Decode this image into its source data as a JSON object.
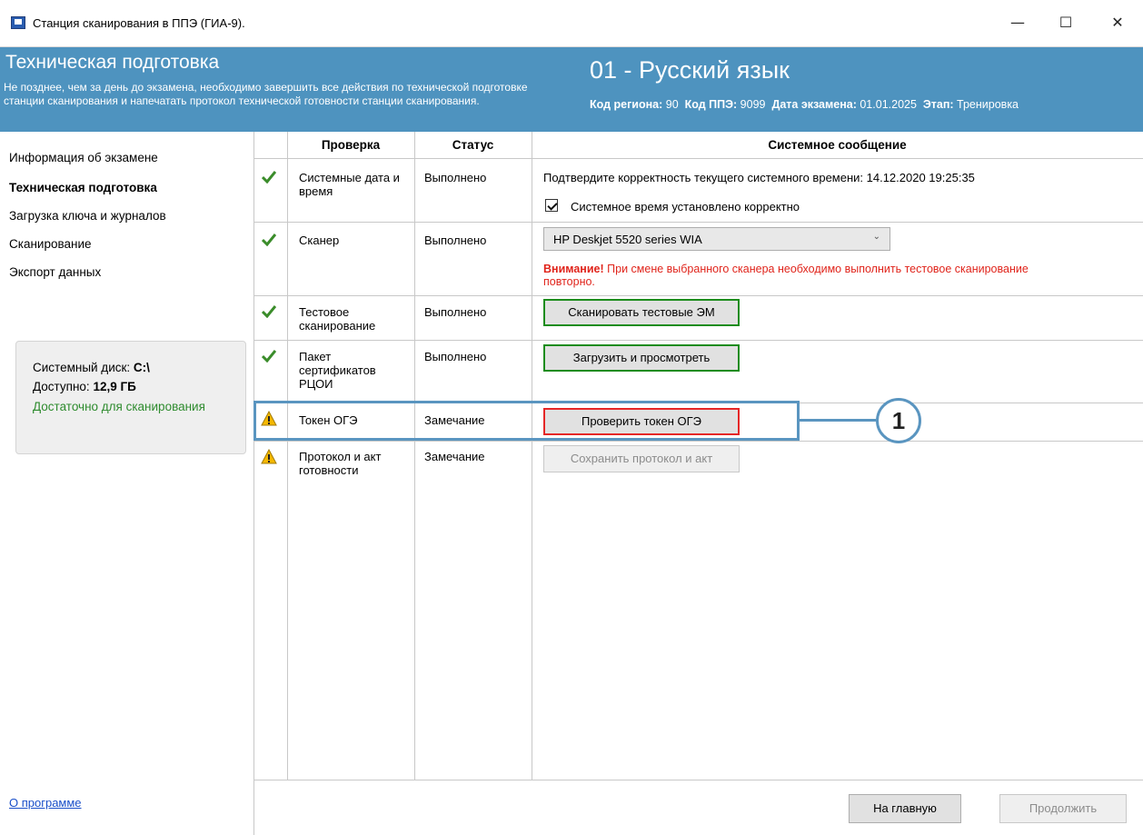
{
  "window": {
    "title": "Станция сканирования в ППЭ (ГИА-9).",
    "minimize": "—",
    "maximize": "☐",
    "close": "✕"
  },
  "header": {
    "title": "Техническая подготовка",
    "description": "Не позднее, чем за день до экзамена, необходимо завершить все действия по технической подготовке станции сканирования и напечатать протокол технической готовности станции сканирования.",
    "subject": "01 - Русский язык",
    "region_label": "Код региона:",
    "region_value": "90",
    "ppe_label": "Код ППЭ:",
    "ppe_value": "9099",
    "date_label": "Дата экзамена:",
    "date_value": "01.01.2025",
    "stage_label": "Этап:",
    "stage_value": "Тренировка"
  },
  "sidebar": {
    "items": [
      {
        "label": "Информация об экзамене",
        "active": false
      },
      {
        "label": "Техническая подготовка",
        "active": true
      },
      {
        "label": "Загрузка ключа и журналов",
        "active": false
      },
      {
        "label": "Сканирование",
        "active": false
      },
      {
        "label": "Экспорт данных",
        "active": false
      }
    ],
    "disk": {
      "disk_label": "Системный диск:",
      "disk_value": "C:\\",
      "free_label": "Доступно:",
      "free_value": "12,9 ГБ",
      "status": "Достаточно для сканирования"
    },
    "about": "О программе"
  },
  "table": {
    "headers": {
      "check": "Проверка",
      "status": "Статус",
      "message": "Системное сообщение"
    },
    "rows": [
      {
        "icon": "check-icon",
        "check": "Системные дата и время",
        "status": "Выполнено"
      },
      {
        "icon": "check-icon",
        "check": "Сканер",
        "status": "Выполнено"
      },
      {
        "icon": "check-icon",
        "check": "Тестовое сканирование",
        "status": "Выполнено"
      },
      {
        "icon": "check-icon",
        "check": "Пакет сертификатов РЦОИ",
        "status": "Выполнено"
      },
      {
        "icon": "warning-icon",
        "check": "Токен ОГЭ",
        "status": "Замечание"
      },
      {
        "icon": "warning-icon",
        "check": "Протокол и акт готовности",
        "status": "Замечание"
      }
    ],
    "time_message": "Подтвердите корректность текущего системного времени: 14.12.2020 19:25:35",
    "time_checkbox": "Системное время установлено корректно",
    "scanner_selected": "HP Deskjet 5520 series WIA",
    "scanner_warning_bold": "Внимание!",
    "scanner_warning_text": " При смене выбранного сканера необходимо выполнить тестовое сканирование повторно.",
    "btn_test_scan": "Сканировать тестовые ЭМ",
    "btn_certificates": "Загрузить и просмотреть",
    "btn_token": "Проверить токен ОГЭ",
    "btn_protocol": "Сохранить протокол и акт"
  },
  "callout": {
    "number": "1"
  },
  "footer": {
    "home": "На главную",
    "continue": "Продолжить"
  },
  "colors": {
    "header_bg": "#4e93bf",
    "success": "#2e8b2e",
    "warning": "#e0241b",
    "callout": "#5a95c0"
  }
}
